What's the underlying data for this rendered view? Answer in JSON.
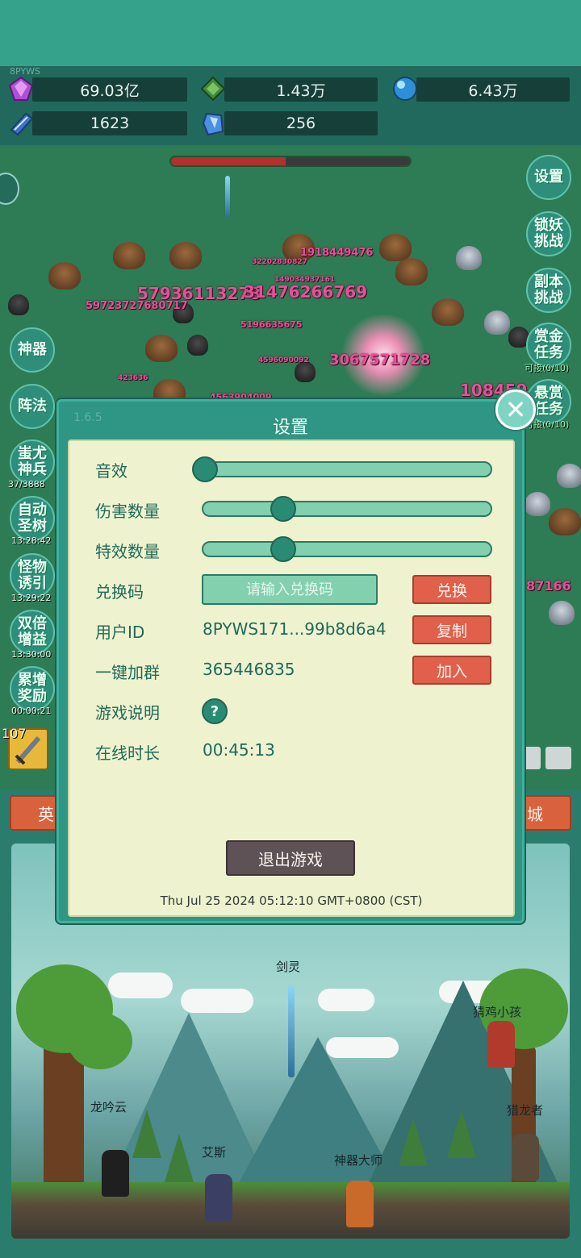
{
  "resources": {
    "player_tag": "8PYWS",
    "gem": "69.03亿",
    "emerald": "1.43万",
    "orb": "6.43万",
    "book": "1623",
    "crystal": "256"
  },
  "boss_hp_fraction": 0.48,
  "damage_numbers": [
    "57936113278",
    "31476266769",
    "59723727680717",
    "1918449476",
    "3067571728",
    "108459",
    "5196635675",
    "87166",
    "32202830827",
    "149034937161",
    "4596090092",
    "4563904009",
    "423636"
  ],
  "side_buttons": {
    "left": [
      {
        "label": "神器"
      },
      {
        "label": "阵法"
      },
      {
        "label": "蚩尤\n神兵",
        "timer": "37/3888"
      },
      {
        "label": "自动\n圣树",
        "timer": "13:28:42"
      },
      {
        "label": "怪物\n诱引",
        "timer": "13:29:22"
      },
      {
        "label": "双倍\n增益",
        "timer": "13:30:00"
      },
      {
        "label": "累增\n奖励",
        "timer": "00:00:21"
      }
    ],
    "right": [
      {
        "label": "设置"
      },
      {
        "label": "锁妖\n挑战"
      },
      {
        "label": "副本\n挑战"
      },
      {
        "label": "赏金\n任务",
        "timer": "可接(0/10)"
      },
      {
        "label": "悬赏\n任务",
        "timer": "可接(0/10)"
      }
    ]
  },
  "level_badge": "107",
  "bottom_tabs": {
    "left": "英",
    "right": "城"
  },
  "scene_npcs": [
    "剑灵",
    "猜鸡小孩",
    "龙吟云",
    "猎龙者",
    "艾斯",
    "神器大师"
  ],
  "dialog": {
    "version": "1.6.5",
    "title": "设置",
    "sound_label": "音效",
    "sound_level": 0.0,
    "damage_label": "伤害数量",
    "damage_level": 0.3,
    "effect_label": "特效数量",
    "effect_level": 0.3,
    "redeem_label": "兑换码",
    "redeem_placeholder": "请输入兑换码",
    "redeem_value": "",
    "redeem_button": "兑换",
    "uid_label": "用户ID",
    "uid_value": "8PYWS171...99b8d6a4",
    "copy_button": "复制",
    "group_label": "一键加群",
    "group_value": "365446835",
    "join_button": "加入",
    "guide_label": "游戏说明",
    "guide_icon": "?",
    "online_label": "在线时长",
    "online_value": "00:45:13",
    "exit_button": "退出游戏",
    "timestamp": "Thu Jul 25 2024 05:12:10 GMT+0800 (CST)"
  }
}
